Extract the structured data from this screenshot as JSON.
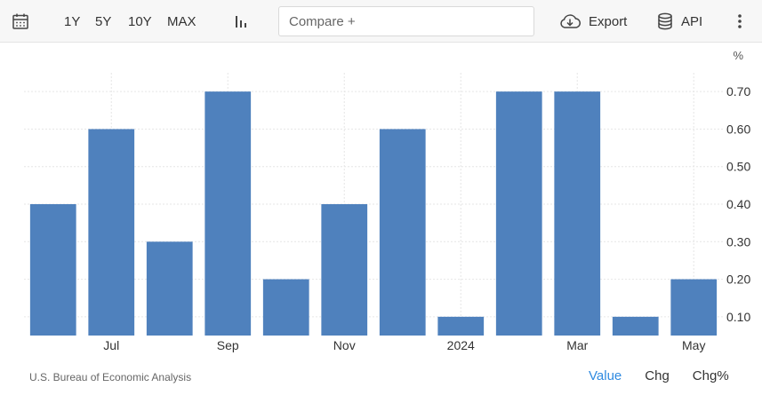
{
  "toolbar": {
    "ranges": [
      "1Y",
      "5Y",
      "10Y",
      "MAX"
    ],
    "compare_placeholder": "Compare +",
    "export_label": "Export",
    "api_label": "API"
  },
  "chart_data": {
    "type": "bar",
    "unit_label": "%",
    "x": [
      "2023-06",
      "2023-07",
      "2023-08",
      "2023-09",
      "2023-10",
      "2023-11",
      "2023-12",
      "2024-01",
      "2024-02",
      "2024-03",
      "2024-04",
      "2024-05"
    ],
    "values": [
      0.4,
      0.6,
      0.3,
      0.7,
      0.2,
      0.4,
      0.6,
      0.1,
      0.7,
      0.7,
      0.1,
      0.2
    ],
    "x_tick_labels": [
      {
        "x": "2023-07",
        "label": "Jul"
      },
      {
        "x": "2023-09",
        "label": "Sep"
      },
      {
        "x": "2023-11",
        "label": "Nov"
      },
      {
        "x": "2024-01",
        "label": "2024"
      },
      {
        "x": "2024-03",
        "label": "Mar"
      },
      {
        "x": "2024-05",
        "label": "May"
      }
    ],
    "y_ticks": [
      "0.10",
      "0.20",
      "0.30",
      "0.40",
      "0.50",
      "0.60",
      "0.70"
    ],
    "ylim": [
      0.05,
      0.75
    ],
    "y_axis_side": "right",
    "grid": true,
    "bar_color": "#4f81bd"
  },
  "footer": {
    "source": "U.S. Bureau of Economic Analysis",
    "tabs": [
      "Value",
      "Chg",
      "Chg%"
    ],
    "active_tab": "Value"
  }
}
